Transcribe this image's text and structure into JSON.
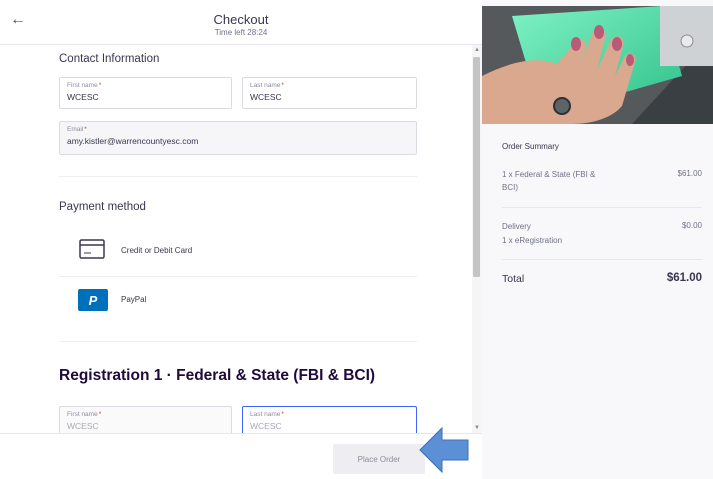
{
  "header": {
    "title": "Checkout",
    "timer": "Time left 28:24"
  },
  "contact": {
    "title": "Contact Information",
    "first_name": {
      "label": "First name",
      "value": "WCESC"
    },
    "last_name": {
      "label": "Last name",
      "value": "WCESC"
    },
    "email": {
      "label": "Email",
      "value": "amy.kistler@warrencountyesc.com"
    }
  },
  "payment": {
    "title": "Payment method",
    "options": [
      {
        "label": "Credit or Debit Card",
        "icon": "credit-card-icon"
      },
      {
        "label": "PayPal",
        "icon": "paypal-icon"
      }
    ]
  },
  "registration": {
    "title": "Registration 1 · Federal & State (FBI & BCI)",
    "first_name": {
      "label": "First name",
      "value": "WCESC"
    },
    "last_name": {
      "label": "Last name",
      "value": "WCESC"
    }
  },
  "footer": {
    "place_order": "Place Order"
  },
  "summary": {
    "title": "Order Summary",
    "item_line": "1 x Federal & State (FBI & BCI)",
    "item_price": "$61.00",
    "delivery_label": "Delivery",
    "delivery_detail": "1 x eRegistration",
    "delivery_price": "$0.00",
    "total_label": "Total",
    "total_value": "$61.00"
  },
  "colors": {
    "accent_arrow": "#5b8fd6",
    "paypal_blue": "#0070ba",
    "required_marker": "#d1410c"
  }
}
